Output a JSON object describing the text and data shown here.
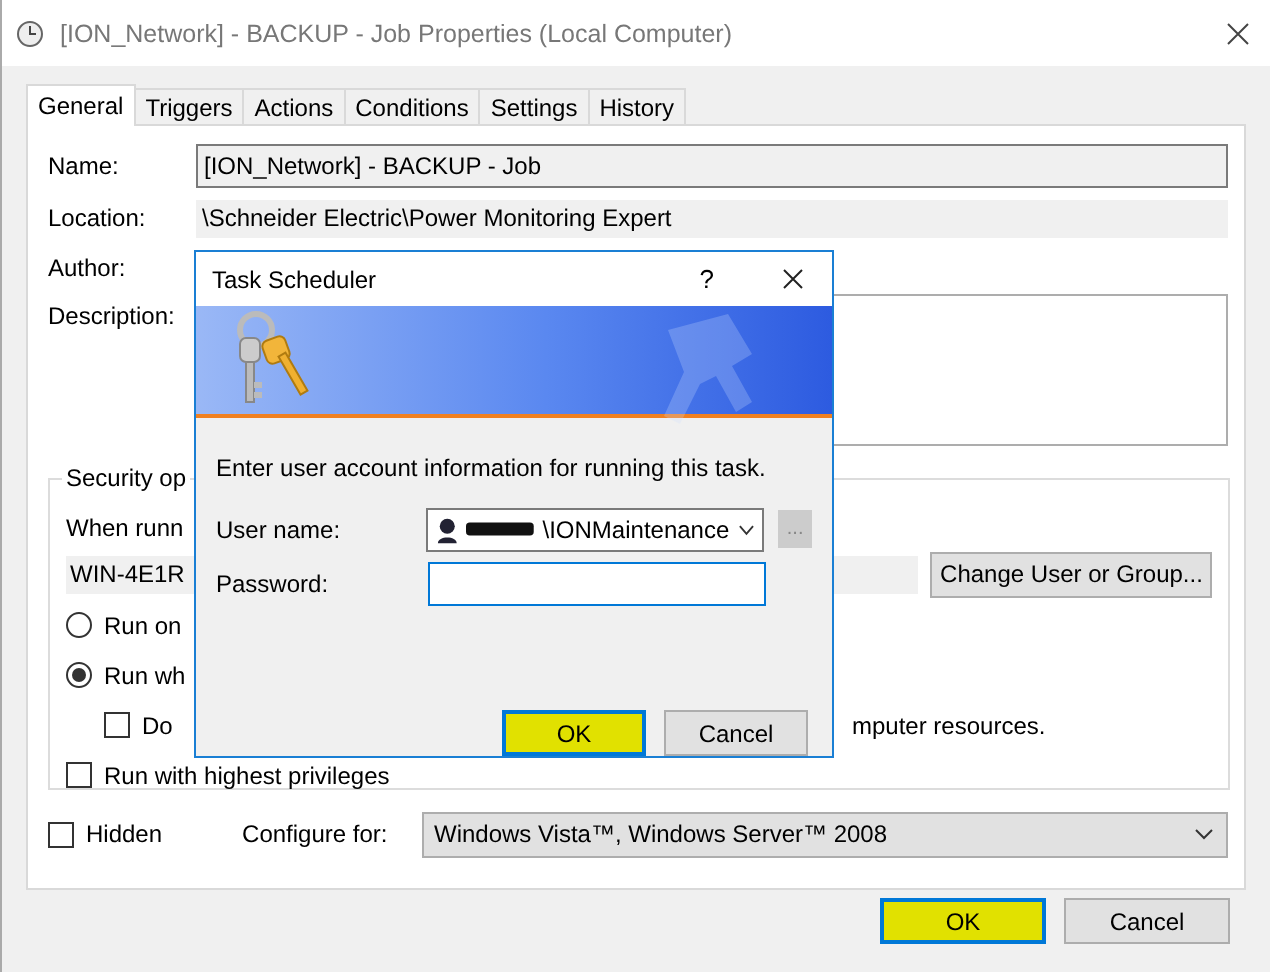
{
  "window": {
    "title": "[ION_Network] - BACKUP - Job Properties (Local Computer)"
  },
  "tabs": [
    {
      "label": "General",
      "selected": true
    },
    {
      "label": "Triggers",
      "selected": false
    },
    {
      "label": "Actions",
      "selected": false
    },
    {
      "label": "Conditions",
      "selected": false
    },
    {
      "label": "Settings",
      "selected": false
    },
    {
      "label": "History",
      "selected": false
    }
  ],
  "general": {
    "name_label": "Name:",
    "name_value": "[ION_Network] - BACKUP - Job",
    "location_label": "Location:",
    "location_value": "\\Schneider Electric\\Power Monitoring Expert",
    "author_label": "Author:",
    "description_label": "Description:"
  },
  "security": {
    "title": "Security op",
    "when_label": "When runn",
    "account": "WIN-4E1R",
    "change_button": "Change User or Group...",
    "options": [
      {
        "kind": "radio",
        "label": "Run on",
        "selected": false
      },
      {
        "kind": "radio",
        "label": "Run wh",
        "selected": true,
        "children": [
          {
            "kind": "checkbox",
            "label": "Do",
            "trailing": "mputer resources.",
            "checked": false
          }
        ]
      },
      {
        "kind": "checkbox",
        "label": "Run with highest privileges",
        "checked": false
      }
    ]
  },
  "hidden": {
    "label": "Hidden",
    "checked": false
  },
  "configure": {
    "label": "Configure for:",
    "value": "Windows Vista™, Windows Server™ 2008"
  },
  "buttons": [
    {
      "label": "OK",
      "highlighted": true
    },
    {
      "label": "Cancel",
      "highlighted": false
    }
  ],
  "dialog": {
    "title": "Task Scheduler",
    "help": "?",
    "prompt": "Enter user account information for running this task.",
    "user_label": "User name:",
    "user_value": "\\IONMaintenance",
    "browse": "...",
    "password_label": "Password:",
    "buttons": [
      {
        "label": "OK",
        "highlighted": true
      },
      {
        "label": "Cancel",
        "highlighted": false
      }
    ]
  }
}
